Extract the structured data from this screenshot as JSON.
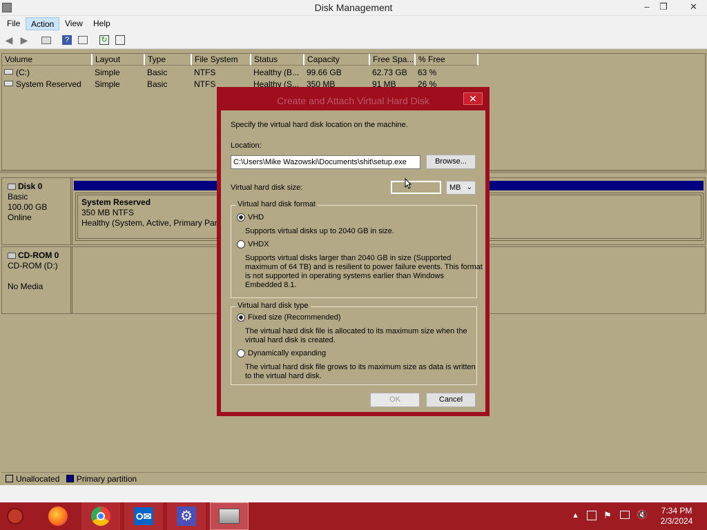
{
  "window": {
    "title": "Disk Management",
    "min_label": "–",
    "max_label": "❐",
    "close_label": "✕"
  },
  "menu": [
    "File",
    "Action",
    "View",
    "Help"
  ],
  "volumes": {
    "headers": [
      "Volume",
      "Layout",
      "Type",
      "File System",
      "Status",
      "Capacity",
      "Free Spa...",
      "% Free"
    ],
    "rows": [
      [
        "(C:)",
        "Simple",
        "Basic",
        "NTFS",
        "Healthy (B...",
        "99.66 GB",
        "62.73 GB",
        "63 %"
      ],
      [
        "System Reserved",
        "Simple",
        "Basic",
        "NTFS",
        "Healthy (S...",
        "350 MB",
        "91 MB",
        "26 %"
      ]
    ]
  },
  "disks": {
    "disk0": {
      "name": "Disk 0",
      "type": "Basic",
      "size": "100.00 GB",
      "state": "Online",
      "partition": {
        "title": "System Reserved",
        "size": "350 MB NTFS",
        "status": "Healthy (System, Active, Primary Partiti"
      }
    },
    "cdrom": {
      "name": "CD-ROM 0",
      "drive": "CD-ROM (D:)",
      "media": "No Media"
    }
  },
  "legend": {
    "unallocated": "Unallocated",
    "primary": "Primary partition"
  },
  "dialog": {
    "title": "Create and Attach Virtual Hard Disk",
    "intro": "Specify the virtual hard disk location on the machine.",
    "location_label": "Location:",
    "location_value": "C:\\Users\\Mike Wazowski\\Documents\\shit\\setup.exe",
    "browse": "Browse...",
    "size_label": "Virtual hard disk size:",
    "size_value": "",
    "size_unit": "MB",
    "format_group": "Virtual hard disk format",
    "vhd_label": "VHD",
    "vhd_desc": "Supports virtual disks up to 2040 GB in size.",
    "vhdx_label": "VHDX",
    "vhdx_desc": [
      "Supports virtual disks larger than 2040 GB in size (Supported",
      "maximum of 64 TB) and is resilient to power failure events. This format",
      "is not supported in operating systems earlier than Windows",
      "Embedded 8.1."
    ],
    "type_group": "Virtual hard disk type",
    "fixed_label": "Fixed size (Recommended)",
    "fixed_desc": [
      "The virtual hard disk file is allocated to its maximum size when the",
      "virtual hard disk is created."
    ],
    "dynamic_label": "Dynamically expanding",
    "dynamic_desc": [
      "The virtual hard disk file grows to its maximum size as data is written",
      "to the virtual hard disk."
    ],
    "ok": "OK",
    "cancel": "Cancel"
  },
  "clock": {
    "time": "7:34 PM",
    "date": "2/3/2024"
  },
  "colors": {
    "unallocated": "#000000",
    "primary": "#000080",
    "taskbar": "#9e1b22"
  }
}
